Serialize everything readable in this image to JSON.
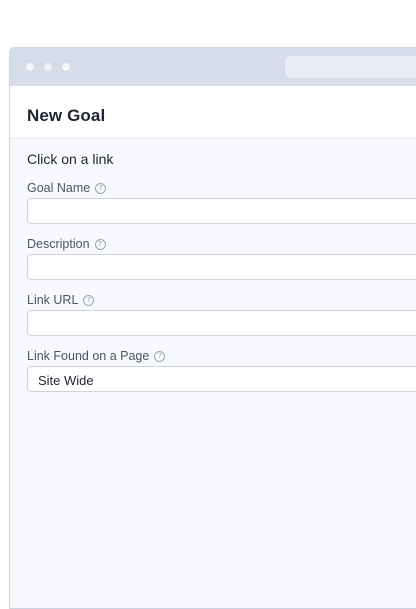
{
  "header": {
    "title": "New Goal"
  },
  "form": {
    "subtitle": "Click on a link",
    "fields": [
      {
        "label": "Goal Name",
        "value": "",
        "type": "text"
      },
      {
        "label": "Description",
        "value": "",
        "type": "text"
      },
      {
        "label": "Link URL",
        "value": "",
        "type": "text"
      },
      {
        "label": "Link Found on a Page",
        "value": "Site Wide",
        "type": "select"
      }
    ]
  },
  "icons": {
    "help": "help-icon"
  },
  "colors": {
    "titlebar": "#d6dde8",
    "background": "#f8f9fc",
    "border": "#ccd3de"
  }
}
